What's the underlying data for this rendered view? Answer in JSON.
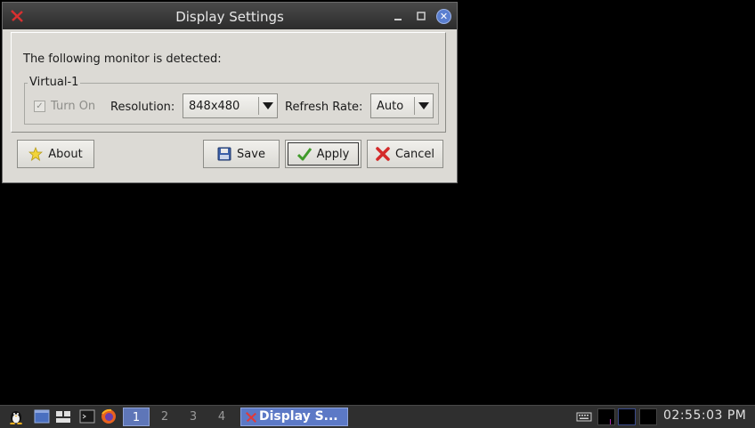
{
  "window": {
    "title": "Display Settings",
    "detected_text": "The following monitor is detected:",
    "monitor": {
      "name": "Virtual-1",
      "turn_on_label": "Turn On",
      "turn_on_checked": true,
      "turn_on_enabled": false,
      "resolution_label": "Resolution:",
      "resolution_value": "848x480",
      "refresh_label": "Refresh Rate:",
      "refresh_value": "Auto"
    },
    "buttons": {
      "about": "About",
      "save": "Save",
      "apply": "Apply",
      "cancel": "Cancel"
    }
  },
  "taskbar": {
    "desktops": [
      "1",
      "2",
      "3",
      "4"
    ],
    "active_desktop": "1",
    "task_label": "Display S...",
    "clock": "02:55:03 PM"
  },
  "colors": {
    "desktop_bg": "#000000",
    "window_bg": "#dcdad5",
    "titlebar_bg": "#333333",
    "taskbar_bg": "#2f2f2f",
    "task_active_bg": "#5c79c6"
  }
}
